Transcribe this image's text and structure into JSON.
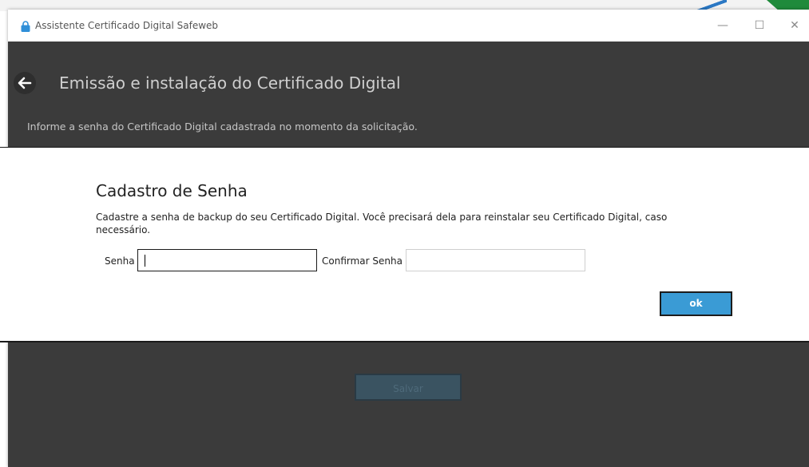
{
  "window": {
    "title": "Assistente Certificado Digital Safeweb",
    "controls": {
      "minimize": "—",
      "maximize": "☐",
      "close": "✕"
    }
  },
  "page": {
    "heading": "Emissão e instalação do Certificado Digital",
    "instruction": "Informe a senha do Certificado Digital cadastrada no momento da solicitação.",
    "bottom_button_label": "Salvar"
  },
  "dialog": {
    "title": "Cadastro de Senha",
    "description": "Cadastre a senha de backup do seu Certificado Digital. Você precisará dela para reinstalar seu Certificado Digital, caso necessário.",
    "senha_label": "Senha",
    "senha_value": "",
    "confirm_label": "Confirmar Senha",
    "confirm_value": "",
    "ok_label": "ok"
  },
  "icons": {
    "app": "lock-icon",
    "back": "back-arrow-icon"
  },
  "colors": {
    "background_dim": "#3b3b3b",
    "accent_button": "#3a9bd5",
    "app_icon": "#2f8fd8"
  }
}
